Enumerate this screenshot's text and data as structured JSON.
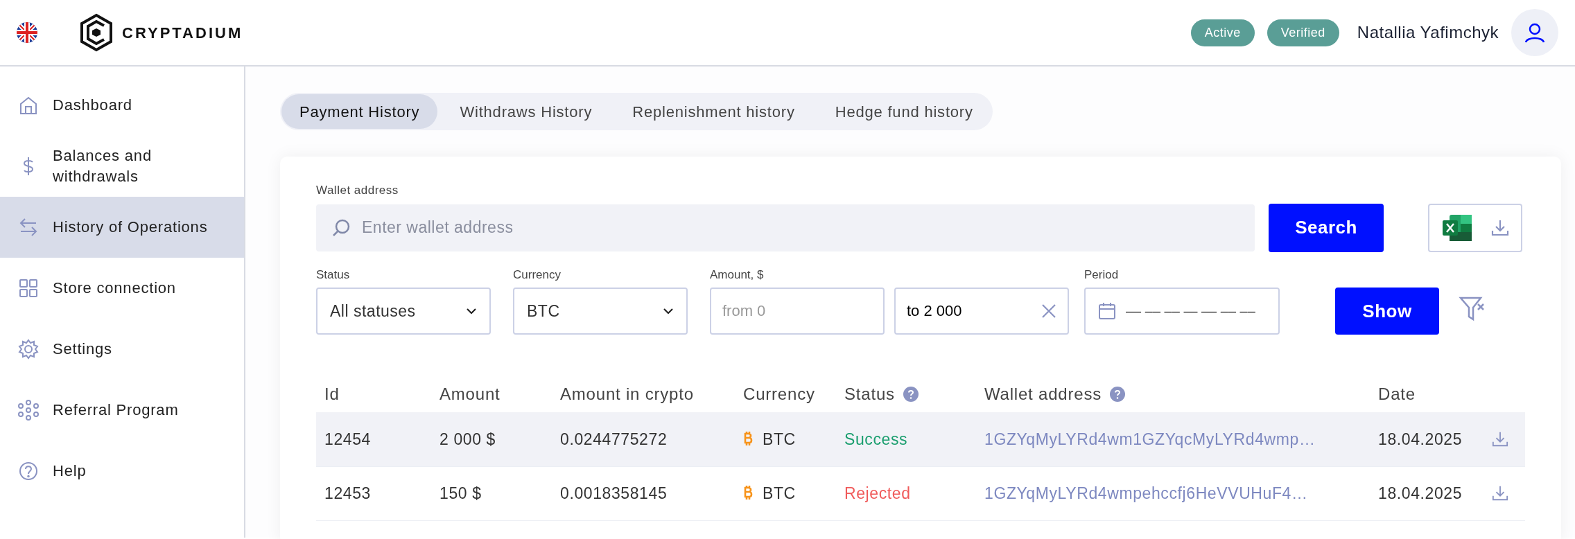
{
  "header": {
    "logo": "CRYPTADIUM",
    "badges": [
      "Active",
      "Verified"
    ],
    "user_name": "Natallia Yafimchyk"
  },
  "sidebar": {
    "items": [
      {
        "label": "Dashboard",
        "selected": false
      },
      {
        "label": "Balances and withdrawals",
        "selected": false
      },
      {
        "label": "History of Operations",
        "selected": true
      },
      {
        "label": "Store connection",
        "selected": false
      },
      {
        "label": "Settings",
        "selected": false
      },
      {
        "label": "Referral Program",
        "selected": false
      },
      {
        "label": "Help",
        "selected": false
      }
    ]
  },
  "tabs": [
    {
      "label": "Payment History",
      "selected": true
    },
    {
      "label": "Withdraws History",
      "selected": false
    },
    {
      "label": "Replenishment history",
      "selected": false
    },
    {
      "label": "Hedge fund history",
      "selected": false
    }
  ],
  "search": {
    "label": "Wallet address",
    "placeholder": "Enter wallet address",
    "button": "Search"
  },
  "filters": {
    "status": {
      "label": "Status",
      "value": "All statuses"
    },
    "currency": {
      "label": "Currency",
      "value": "BTC"
    },
    "amount": {
      "label": "Amount, $",
      "from_placeholder": "from 0",
      "to_value": "to 2 000"
    },
    "period": {
      "label": "Period",
      "placeholder": "–– –– –– — –– –– ––"
    },
    "button": "Show"
  },
  "table": {
    "columns": [
      "Id",
      "Amount",
      "Amount in crypto",
      "Currency",
      "Status",
      "Wallet address",
      "Date"
    ],
    "rows": [
      {
        "id": "12454",
        "amount": "2 000 $",
        "crypto": "0.0244775272",
        "currency": "BTC",
        "status": "Success",
        "color": "#1a9e6e",
        "wallet": "1GZYqMyLYRd4wm1GZYqcMyLYRd4wmp…",
        "date": "18.04.2025",
        "selected": true
      },
      {
        "id": "12453",
        "amount": "150 $",
        "crypto": "0.0018358145",
        "currency": "BTC",
        "status": "Rejected",
        "color": "#f05a5a",
        "wallet": "1GZYqMyLYRd4wmpehccfj6HeVVUHuF4…",
        "date": "18.04.2025",
        "selected": false
      }
    ]
  }
}
